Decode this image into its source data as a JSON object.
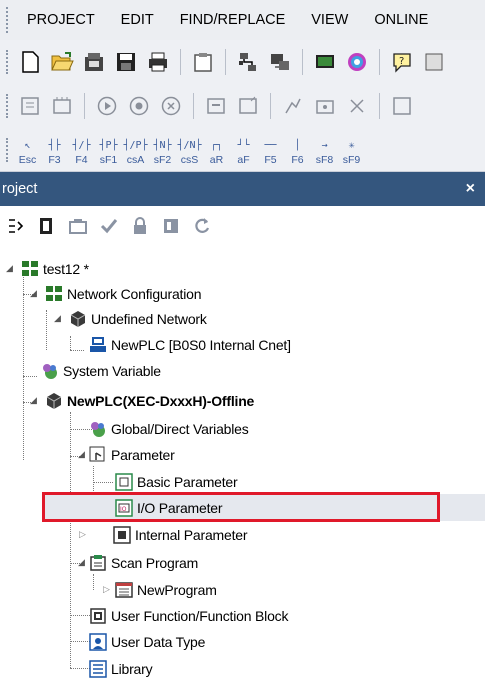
{
  "menu": [
    "PROJECT",
    "EDIT",
    "FIND/REPLACE",
    "VIEW",
    "ONLINE"
  ],
  "function_keys": [
    {
      "label": "Esc",
      "icon": "contact-a"
    },
    {
      "label": "F3",
      "icon": "contact-no"
    },
    {
      "label": "F4",
      "icon": "contact-nc"
    },
    {
      "label": "sF1",
      "icon": "contact-p"
    },
    {
      "label": "csA",
      "icon": "contact-n"
    },
    {
      "label": "sF2",
      "icon": "contact-np"
    },
    {
      "label": "csS",
      "icon": "contact-nn"
    },
    {
      "label": "aR",
      "icon": "contact-pulse-r"
    },
    {
      "label": "aF",
      "icon": "contact-pulse-f"
    },
    {
      "label": "F5",
      "icon": "horizontal-line"
    },
    {
      "label": "F6",
      "icon": "vertical-line"
    },
    {
      "label": "sF8",
      "icon": "arrow"
    },
    {
      "label": "sF9",
      "icon": "asterisk"
    }
  ],
  "panel": {
    "title": "roject",
    "close": "×"
  },
  "tree": {
    "root": "test12 *",
    "network_config": "Network Configuration",
    "undefined_network": "Undefined Network",
    "newplc_cnet": "NewPLC [B0S0 Internal Cnet]",
    "system_variable": "System Variable",
    "plc": "NewPLC(XEC-DxxxH)-Offline",
    "global_vars": "Global/Direct Variables",
    "parameter": "Parameter",
    "basic_param": "Basic Parameter",
    "io_param": "I/O Parameter",
    "internal_param": "Internal Parameter",
    "scan_program": "Scan Program",
    "new_program": "NewProgram",
    "user_function": "User Function/Function Block",
    "user_data_type": "User Data Type",
    "library": "Library"
  },
  "colors": {
    "title_bar": "#34567e",
    "highlight": "#e0192a",
    "toolbar_bg": "#eef0f4"
  }
}
